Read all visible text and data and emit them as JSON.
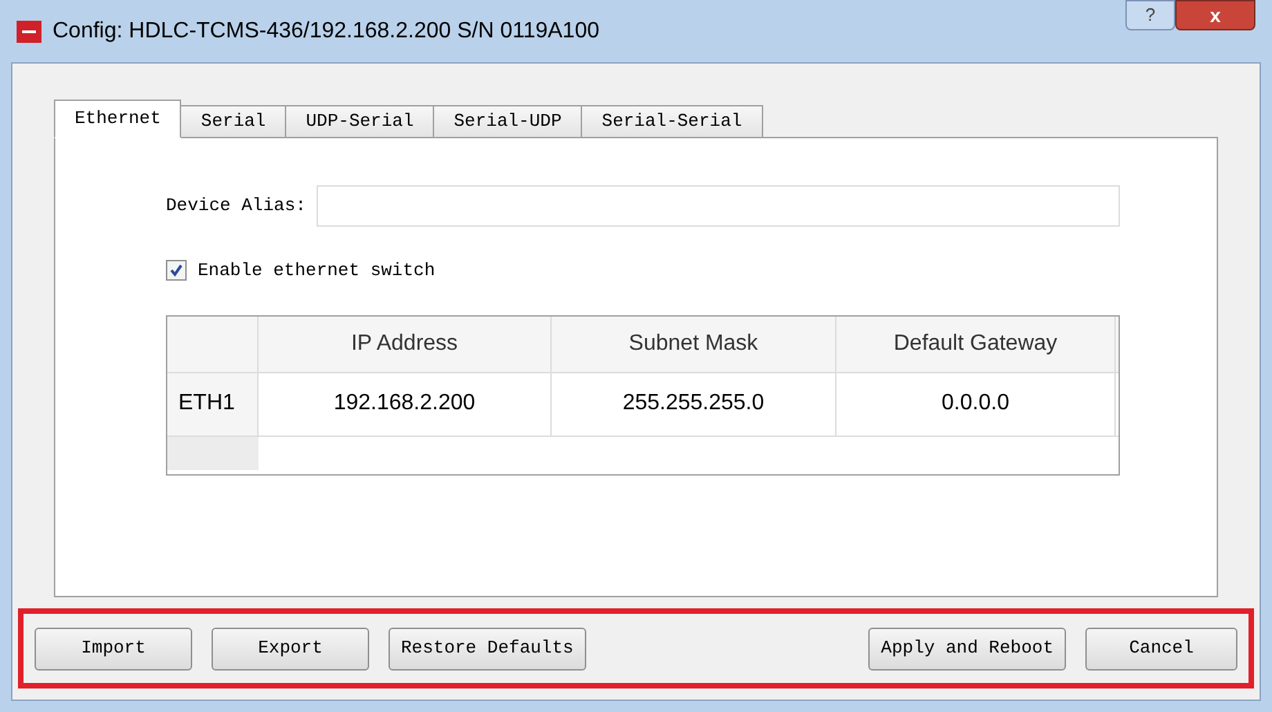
{
  "window": {
    "title": "Config: HDLC-TCMS-436/192.168.2.200  S/N 0119A100",
    "help_button": "?",
    "close_button": "x"
  },
  "tabs": [
    {
      "label": "Ethernet",
      "selected": true
    },
    {
      "label": "Serial",
      "selected": false
    },
    {
      "label": "UDP-Serial",
      "selected": false
    },
    {
      "label": "Serial-UDP",
      "selected": false
    },
    {
      "label": "Serial-Serial",
      "selected": false
    }
  ],
  "device_alias": {
    "label": "Device Alias:"
  },
  "enable_switch": {
    "label": "Enable ethernet switch",
    "checked": true
  },
  "table": {
    "columns": [
      "IP Address",
      "Subnet Mask",
      "Default Gateway"
    ],
    "rows": [
      {
        "header": "ETH1",
        "cells": [
          "192.168.2.200",
          "255.255.255.0",
          "0.0.0.0"
        ]
      }
    ]
  },
  "buttons_left": [
    "Import",
    "Export",
    "Restore Defaults"
  ],
  "buttons_right": [
    "Apply and Reboot",
    "Cancel"
  ]
}
